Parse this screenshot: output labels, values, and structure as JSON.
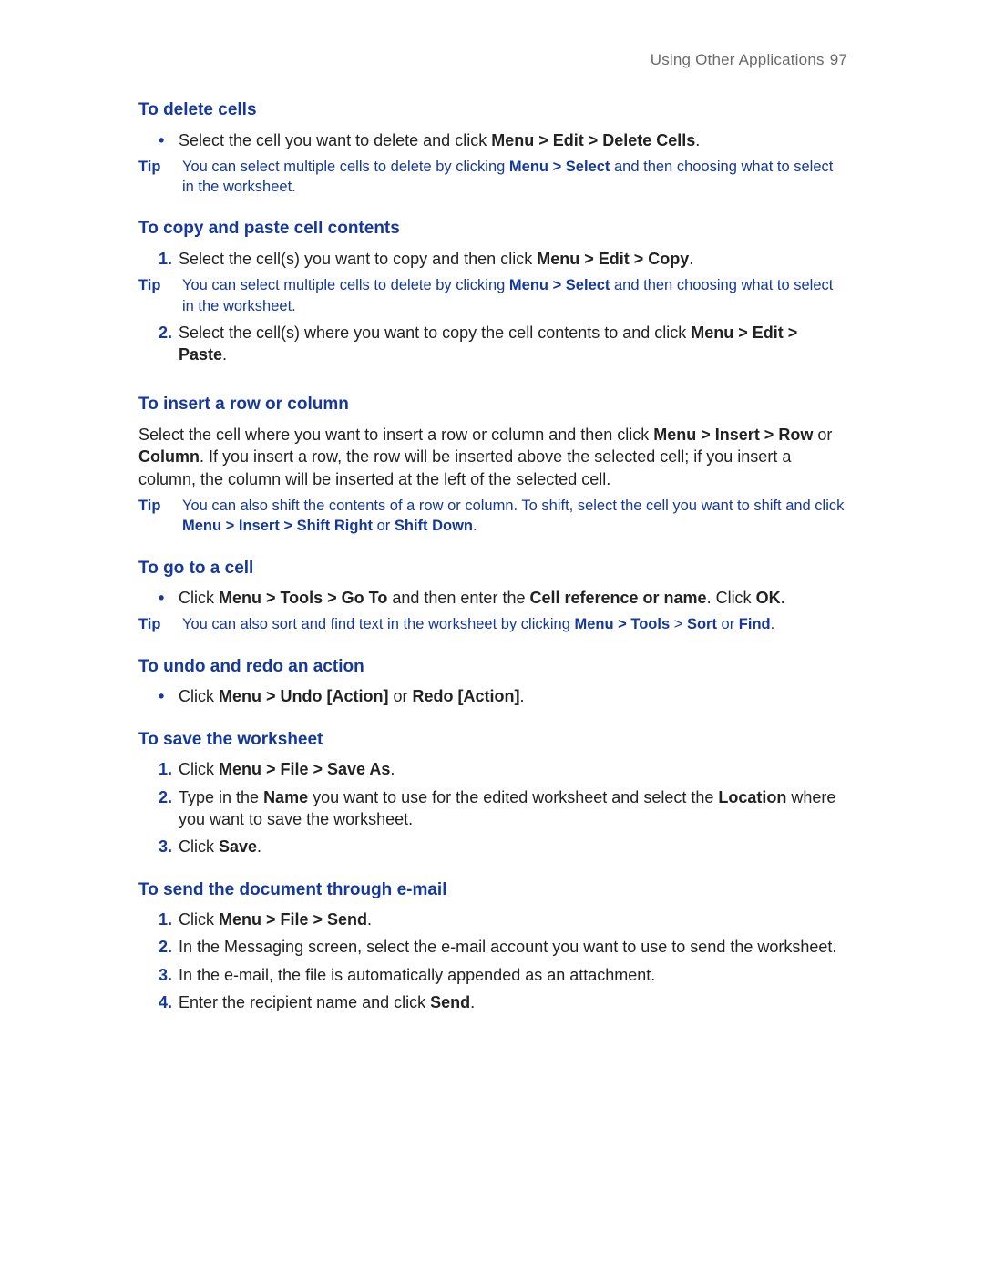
{
  "header": {
    "title": "Using Other Applications",
    "page": "97"
  },
  "s1": {
    "title": "To delete cells",
    "b1_a": "Select the cell you want to delete and click ",
    "b1_b": "Menu > Edit > Delete Cells",
    "b1_c": ".",
    "tip_label": "Tip",
    "tip_a": "You can select multiple cells to delete by clicking ",
    "tip_b": "Menu > Select",
    "tip_c": " and then choosing what to select in the worksheet."
  },
  "s2": {
    "title": "To copy and paste cell contents",
    "n1": "1.",
    "n1_a": "Select the cell(s) you want to copy and then click ",
    "n1_b": "Menu > Edit > Copy",
    "n1_c": ".",
    "tip_label": "Tip",
    "tip_a": "You can select multiple cells to delete by clicking ",
    "tip_b": "Menu > Select",
    "tip_c": " and then choosing what to select in the worksheet.",
    "n2": "2.",
    "n2_a": "Select the cell(s) where you want to copy the cell contents to and click ",
    "n2_b": "Menu > Edit > Paste",
    "n2_c": "."
  },
  "s3": {
    "title": "To insert a row or column",
    "p_a": "Select the cell where you want to insert a row or column and then click ",
    "p_b": "Menu > Insert > Row",
    "p_c": " or ",
    "p_d": "Column",
    "p_e": ". If you insert a row, the row will be inserted above the selected cell; if you insert a column, the column will be inserted at the left of the selected cell.",
    "tip_label": "Tip",
    "tip_a": "You can also shift the contents of a row or column. To shift, select the cell you want to shift and click ",
    "tip_b": "Menu > Insert > Shift Right",
    "tip_c": " or ",
    "tip_d": "Shift Down",
    "tip_e": "."
  },
  "s4": {
    "title": "To go to a cell",
    "b1_a": "Click ",
    "b1_b": "Menu > Tools > Go To",
    "b1_c": " and then enter the ",
    "b1_d": "Cell reference or name",
    "b1_e": ". Click ",
    "b1_f": "OK",
    "b1_g": ".",
    "tip_label": "Tip",
    "tip_a": "You can also sort and find text in the worksheet by clicking ",
    "tip_b": "Menu > Tools",
    "tip_c": " > ",
    "tip_d": "Sort",
    "tip_e": " or ",
    "tip_f": "Find",
    "tip_g": "."
  },
  "s5": {
    "title": "To undo and redo an action",
    "b1_a": "Click ",
    "b1_b": "Menu > Undo [Action]",
    "b1_c": " or ",
    "b1_d": "Redo [Action]",
    "b1_e": "."
  },
  "s6": {
    "title": "To save the worksheet",
    "n1": "1.",
    "n1_a": "Click ",
    "n1_b": "Menu > File > Save As",
    "n1_c": ".",
    "n2": "2.",
    "n2_a": "Type in the ",
    "n2_b": "Name",
    "n2_c": " you want to use for the edited worksheet and select the ",
    "n2_d": "Location",
    "n2_e": " where you want to save the worksheet.",
    "n3": "3.",
    "n3_a": "Click ",
    "n3_b": "Save",
    "n3_c": "."
  },
  "s7": {
    "title": "To send the document through e-mail",
    "n1": "1.",
    "n1_a": "Click ",
    "n1_b": "Menu > File > Send",
    "n1_c": ".",
    "n2": "2.",
    "n2_a": "In the Messaging screen, select the e-mail account you want to use to send the worksheet.",
    "n3": "3.",
    "n3_a": "In the e-mail, the file is automatically appended as an attachment.",
    "n4": "4.",
    "n4_a": "Enter the recipient name and click ",
    "n4_b": "Send",
    "n4_c": "."
  }
}
